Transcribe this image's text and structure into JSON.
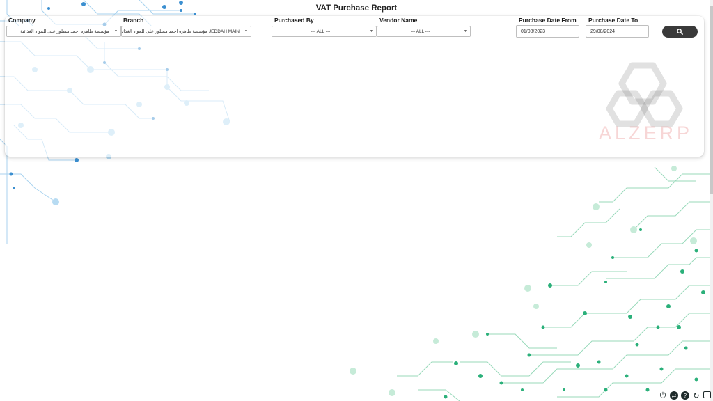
{
  "page": {
    "title": "VAT Purchase Report"
  },
  "filters": {
    "company": {
      "label": "Company",
      "value": "مؤسسة طاهره احمد مسلور على للمواد الغذائية"
    },
    "branch": {
      "label": "Branch",
      "value": "مؤسسة طاهره احمد مسلور على للمواد الغذائية JEDDAH MAIN"
    },
    "purchased_by": {
      "label": "Purchased By",
      "value": "--- ALL ---"
    },
    "vendor_name": {
      "label": "Vendor Name",
      "value": "--- ALL ---"
    },
    "date_from": {
      "label": "Purchase Date From",
      "value": "01/08/2023"
    },
    "date_to": {
      "label": "Purchase Date To",
      "value": "29/08/2024"
    }
  },
  "icons": {
    "search": "search-icon",
    "dropdown": "chevron-down-icon",
    "power": "power-icon",
    "share": "share-icon",
    "help": "help-icon",
    "refresh": "refresh-icon",
    "window": "window-icon"
  },
  "branding": {
    "logo_text": "ALZERP"
  },
  "colors": {
    "circuit_blue": "#3b8fd0",
    "circuit_green": "#2bb07a",
    "button_dark": "#3a3a3a"
  }
}
